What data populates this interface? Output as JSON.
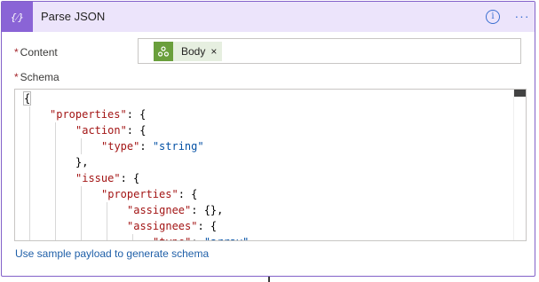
{
  "action_card": {
    "title": "Parse JSON",
    "icon_glyph": "{⁄}",
    "info_glyph": "i",
    "more_glyph": "···",
    "accent_color": "#8a64d6"
  },
  "content_field": {
    "required_mark": "*",
    "label": "Content",
    "token": {
      "label": "Body",
      "remove_glyph": "×",
      "icon": "http-trigger-icon"
    }
  },
  "schema_field": {
    "required_mark": "*",
    "label": "Schema",
    "code_lines": [
      {
        "indent": 0,
        "parts": [
          [
            "p",
            "{"
          ]
        ]
      },
      {
        "indent": 1,
        "parts": [
          [
            "k",
            "\"properties\""
          ],
          [
            "p",
            ": {"
          ]
        ]
      },
      {
        "indent": 2,
        "parts": [
          [
            "k",
            "\"action\""
          ],
          [
            "p",
            ": {"
          ]
        ]
      },
      {
        "indent": 3,
        "parts": [
          [
            "k",
            "\"type\""
          ],
          [
            "p",
            ": "
          ],
          [
            "s",
            "\"string\""
          ]
        ]
      },
      {
        "indent": 2,
        "parts": [
          [
            "p",
            "},"
          ]
        ]
      },
      {
        "indent": 2,
        "parts": [
          [
            "k",
            "\"issue\""
          ],
          [
            "p",
            ": {"
          ]
        ]
      },
      {
        "indent": 3,
        "parts": [
          [
            "k",
            "\"properties\""
          ],
          [
            "p",
            ": {"
          ]
        ]
      },
      {
        "indent": 4,
        "parts": [
          [
            "k",
            "\"assignee\""
          ],
          [
            "p",
            ": {},"
          ]
        ]
      },
      {
        "indent": 4,
        "parts": [
          [
            "k",
            "\"assignees\""
          ],
          [
            "p",
            ": {"
          ]
        ]
      },
      {
        "indent": 5,
        "parts": [
          [
            "k",
            "\"type\""
          ],
          [
            "p",
            ": "
          ],
          [
            "s",
            "\"array\""
          ]
        ]
      }
    ]
  },
  "sample_link": "Use sample payload to generate schema"
}
